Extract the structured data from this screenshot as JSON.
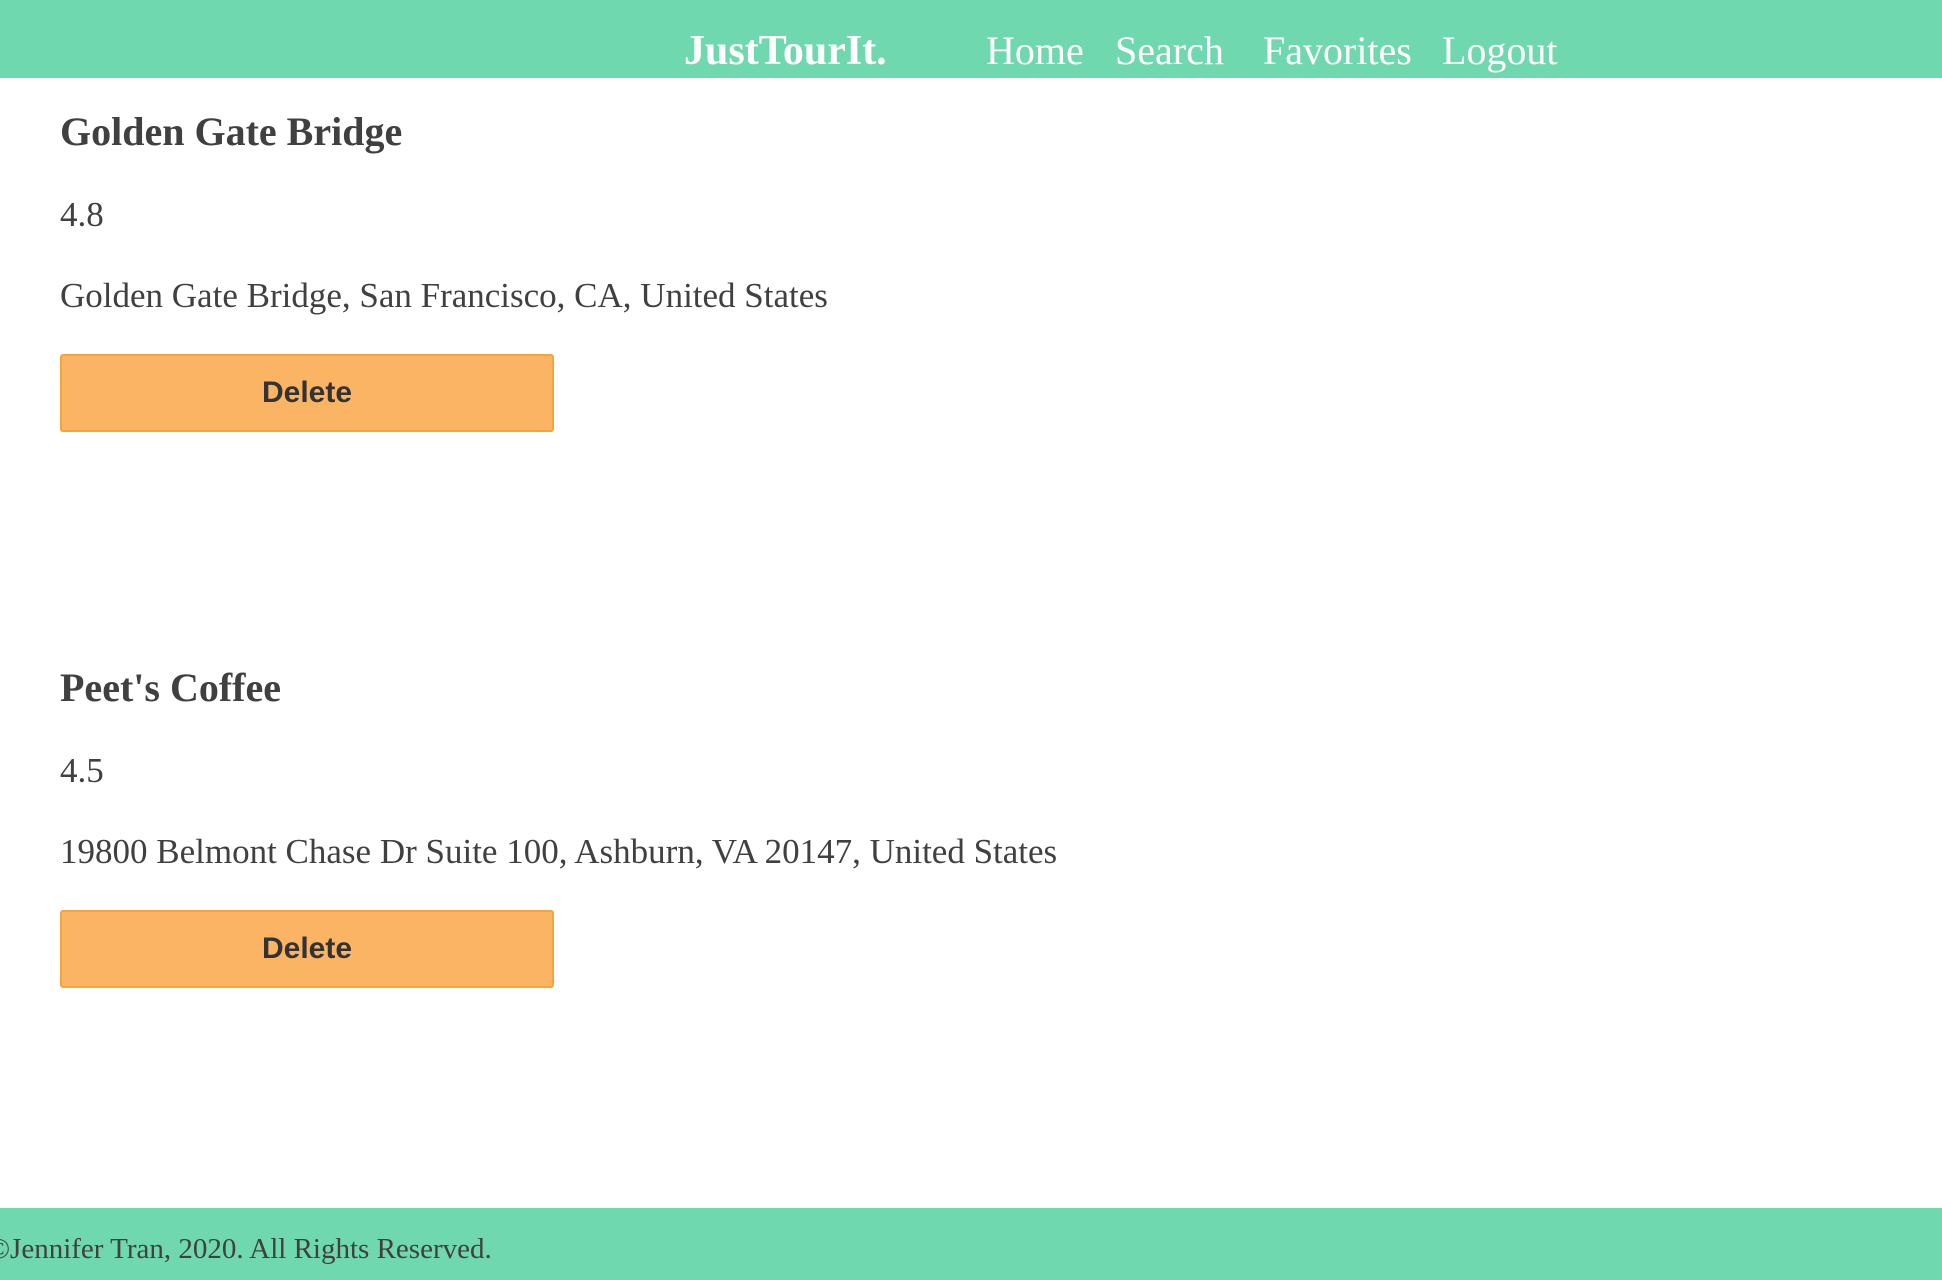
{
  "navbar": {
    "brand": "JustTourIt.",
    "links": {
      "home": "Home",
      "search": "Search",
      "favorites": "Favorites",
      "logout": "Logout"
    }
  },
  "favorites": [
    {
      "name": "Golden Gate Bridge",
      "rating": "4.8",
      "address": "Golden Gate Bridge, San Francisco, CA, United States",
      "delete_label": "Delete"
    },
    {
      "name": "Peet's Coffee",
      "rating": "4.5",
      "address": "19800 Belmont Chase Dr Suite 100, Ashburn, VA 20147, United States",
      "delete_label": "Delete"
    }
  ],
  "footer": {
    "text": "©Jennifer Tran, 2020. All Rights Reserved."
  },
  "colors": {
    "nav_background": "#6fd8ae",
    "button_background": "#fbb464",
    "text": "#404040"
  }
}
